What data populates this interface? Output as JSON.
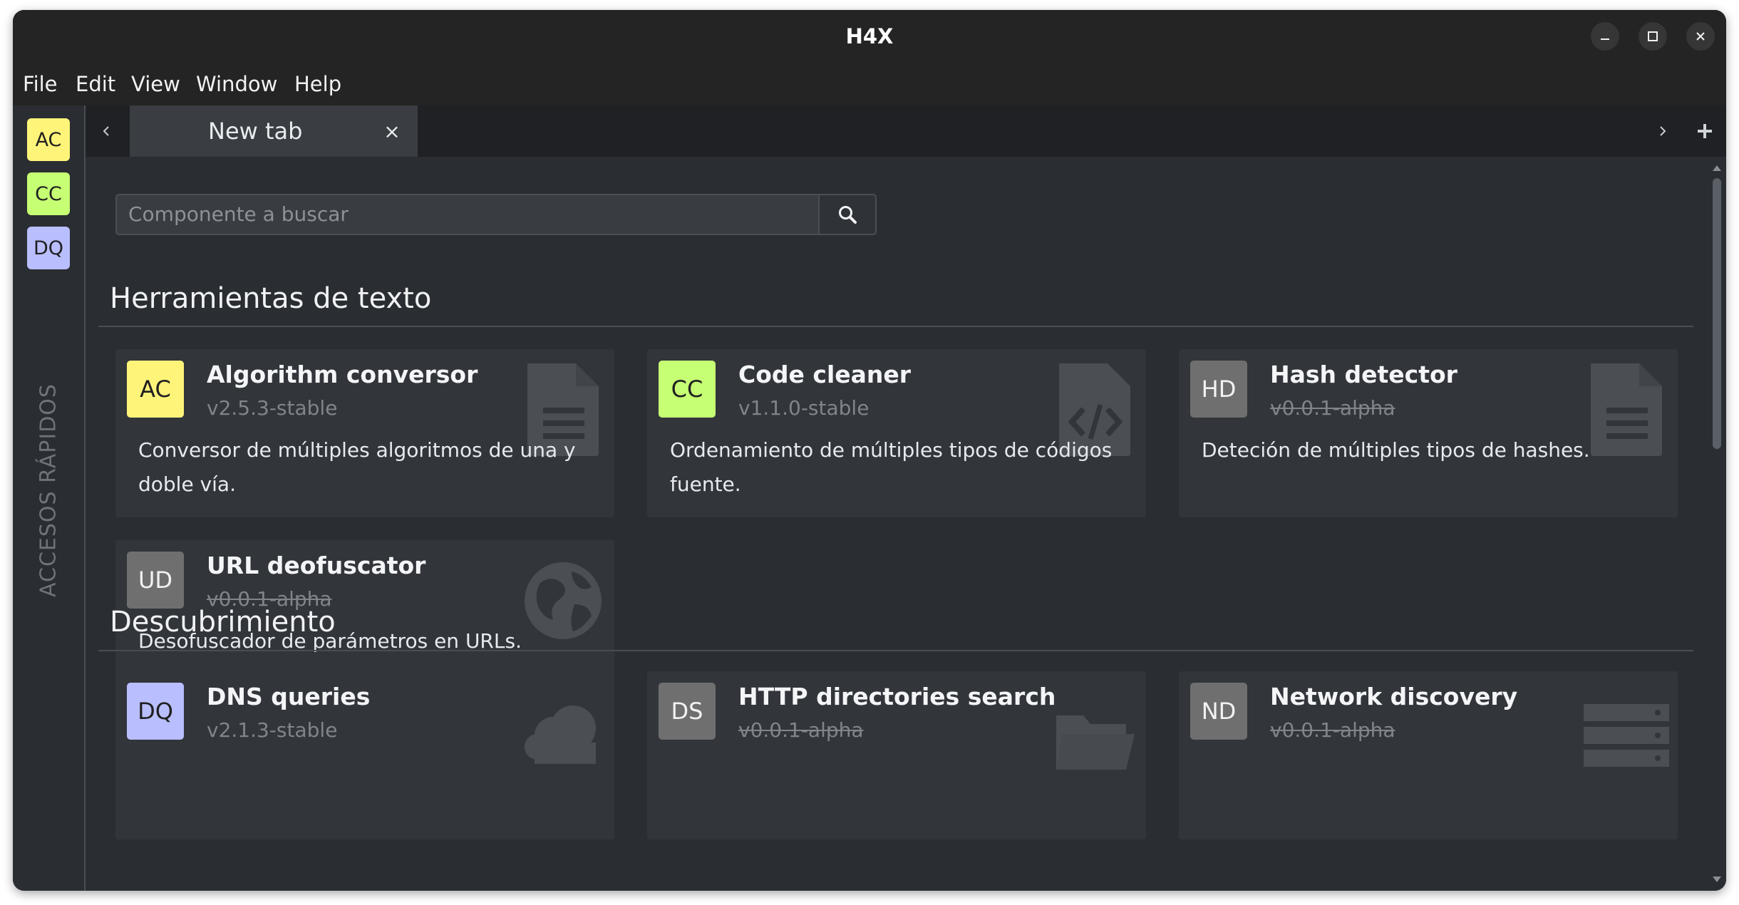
{
  "window": {
    "title": "H4X"
  },
  "menu": [
    "File",
    "Edit",
    "View",
    "Window",
    "Help"
  ],
  "sidebar": {
    "quick_access": [
      {
        "label": "AC",
        "color": "#fff47a"
      },
      {
        "label": "CC",
        "color": "#c6ff74"
      },
      {
        "label": "DQ",
        "color": "#b9beff"
      }
    ],
    "vertical_label": "ACCESOS RÁPIDOS"
  },
  "tabs": {
    "active": {
      "label": "New tab",
      "close": "×"
    }
  },
  "search": {
    "placeholder": "Componente a buscar"
  },
  "sections": [
    {
      "title": "Herramientas de texto",
      "cards": [
        {
          "badge": "AC",
          "badge_color": "#fff47a",
          "title": "Algorithm conversor",
          "version": "v2.5.3-stable",
          "version_strike": false,
          "description": "Conversor de múltiples algoritmos de una y doble vía.",
          "icon": "document-icon"
        },
        {
          "badge": "CC",
          "badge_color": "#c6ff74",
          "title": "Code cleaner",
          "version": "v1.1.0-stable",
          "version_strike": false,
          "description": "Ordenamiento de múltiples tipos de códigos fuente.",
          "icon": "code-file-icon"
        },
        {
          "badge": "HD",
          "badge_color": "#6f6f6f",
          "title": "Hash detector",
          "version": "v0.0.1-alpha",
          "version_strike": true,
          "description": "Deteción de múltiples tipos de hashes.",
          "icon": "document-icon"
        },
        {
          "badge": "UD",
          "badge_color": "#6f6f6f",
          "title": "URL deofuscator",
          "version": "v0.0.1-alpha",
          "version_strike": true,
          "description": "Desofuscador de parámetros en URLs.",
          "icon": "globe-icon"
        }
      ]
    },
    {
      "title": "Descubrimiento",
      "cards": [
        {
          "badge": "DQ",
          "badge_color": "#b9beff",
          "title": "DNS queries",
          "version": "v2.1.3-stable",
          "version_strike": false,
          "description": "",
          "icon": "cloud-icon"
        },
        {
          "badge": "DS",
          "badge_color": "#6f6f6f",
          "title": "HTTP directories search",
          "version": "v0.0.1-alpha",
          "version_strike": true,
          "description": "",
          "icon": "folder-icon"
        },
        {
          "badge": "ND",
          "badge_color": "#6f6f6f",
          "title": "Network discovery",
          "version": "v0.0.1-alpha",
          "version_strike": true,
          "description": "",
          "icon": "server-icon"
        }
      ]
    }
  ]
}
